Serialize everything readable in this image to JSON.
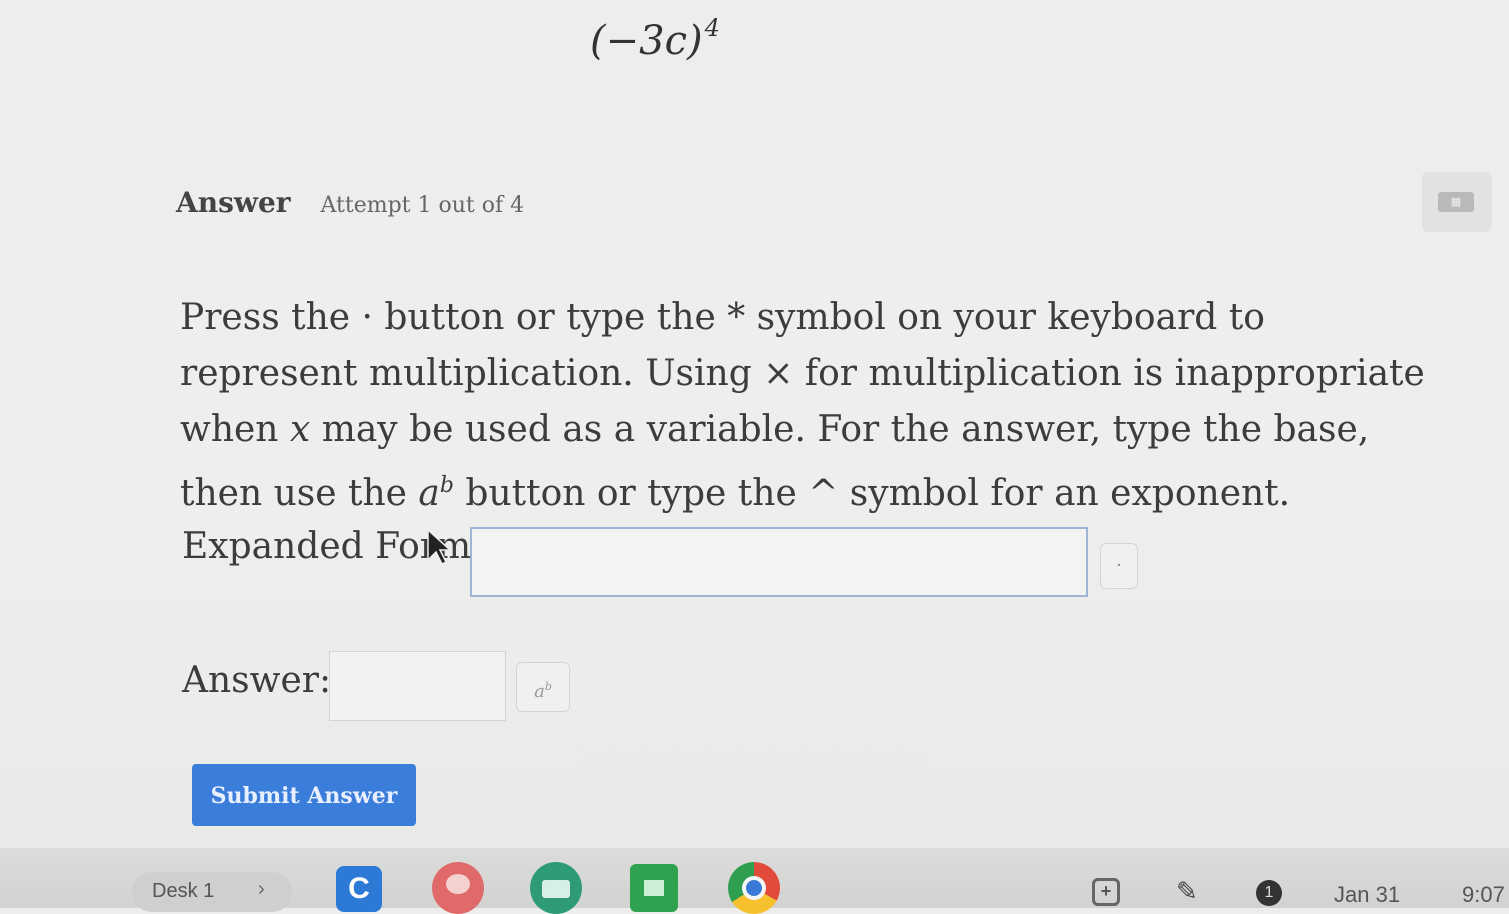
{
  "problem": {
    "base": "(−3c)",
    "exponent": "4"
  },
  "answer_section": {
    "heading": "Answer",
    "attempt": "Attempt 1 out of 4",
    "calculator_icon": "calculator-icon"
  },
  "instructions": {
    "part1": "Press the · button or type the * symbol on your keyboard to represent multiplication. Using × for multiplication is inappropriate when ",
    "var_x": "x",
    "part2": " may be used as a variable. For the answer, type the base, then use the ",
    "ab_base": "a",
    "ab_exp": "b",
    "part3": " button or type the ^ symbol for an exponent."
  },
  "expanded_form": {
    "label": "Expanded Form:",
    "value": "",
    "multiply_button_label": "·"
  },
  "answer_field": {
    "label": "Answer:",
    "value": "",
    "exponent_button_base": "a",
    "exponent_button_exp": "b"
  },
  "submit_label": "Submit Answer",
  "taskbar": {
    "desk_label": "Desk 1",
    "desk_chevron": "›",
    "apps": [
      "classroom-icon",
      "paint-icon",
      "meet-icon",
      "sheets-icon",
      "chrome-icon"
    ],
    "classroom_letter": "C",
    "screenshot_glyph": "+",
    "pen_glyph": "✎",
    "notification_count": "1",
    "date": "Jan 31",
    "time": "9:07"
  }
}
